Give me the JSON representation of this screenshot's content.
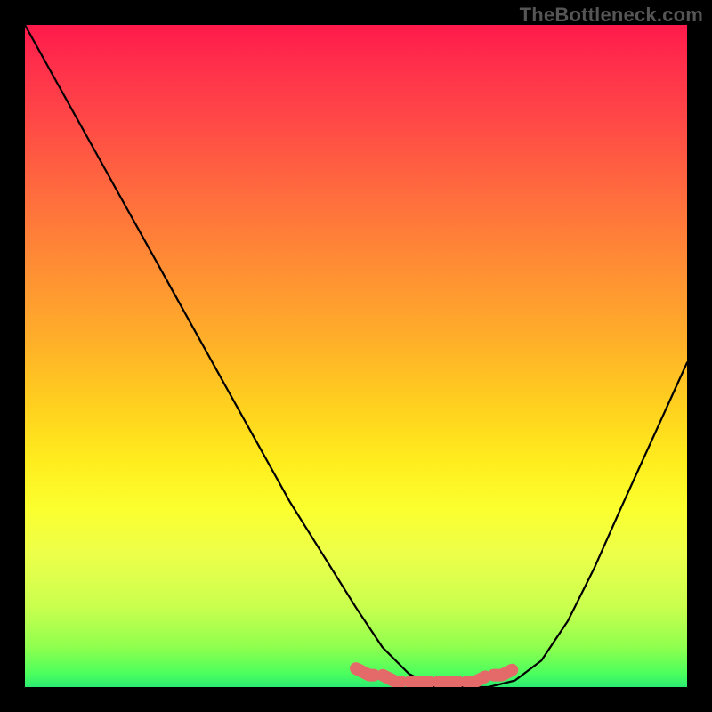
{
  "watermark": "TheBottleneck.com",
  "chart_data": {
    "type": "line",
    "title": "",
    "xlabel": "",
    "ylabel": "",
    "xlim": [
      0,
      100
    ],
    "ylim": [
      0,
      100
    ],
    "series": [
      {
        "name": "curve",
        "x": [
          0,
          5,
          10,
          15,
          20,
          25,
          30,
          35,
          40,
          45,
          50,
          54,
          58,
          62,
          66,
          70,
          74,
          78,
          82,
          86,
          90,
          95,
          100
        ],
        "y": [
          100,
          91,
          82,
          73,
          64,
          55,
          46,
          37,
          28,
          20,
          12,
          6,
          2,
          0,
          0,
          0,
          1,
          4,
          10,
          18,
          27,
          38,
          49
        ]
      }
    ],
    "markers": {
      "name": "bottom-pink-segment",
      "color": "#e46a6a",
      "x": [
        50,
        52,
        54,
        56,
        58,
        60,
        62,
        64,
        66,
        68,
        70,
        72,
        74
      ],
      "y": [
        2,
        1,
        1,
        0,
        0,
        0,
        0,
        0,
        0,
        0,
        1,
        1,
        2
      ]
    },
    "background_gradient": {
      "top": "#ff1a4b",
      "bottom": "#2bea71"
    }
  }
}
